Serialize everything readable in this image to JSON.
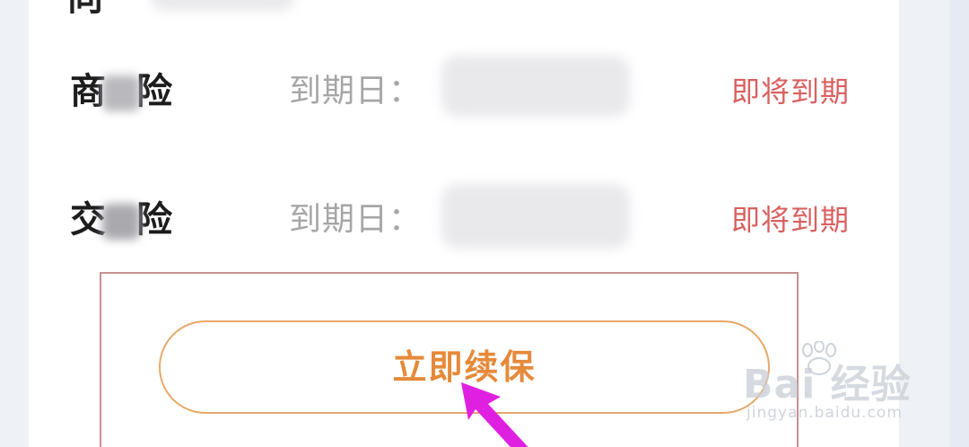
{
  "top_row": {
    "label": "向"
  },
  "insurance_list": [
    {
      "name_prefix": "商",
      "name_suffix": "险",
      "due_label": "到期日：",
      "status": "即将到期"
    },
    {
      "name_prefix": "交",
      "name_suffix": "险",
      "due_label": "到期日：",
      "status": "即将到期"
    }
  ],
  "actions": {
    "renew_label": "立即续保"
  },
  "watermark": {
    "main": "Bai 经验",
    "sub": "jingyan.baidu.com"
  },
  "colors": {
    "status_red": "#d96060",
    "renew_orange": "#e58a3a",
    "highlight_border": "#c98f8f",
    "arrow_magenta": "#e020e0"
  }
}
